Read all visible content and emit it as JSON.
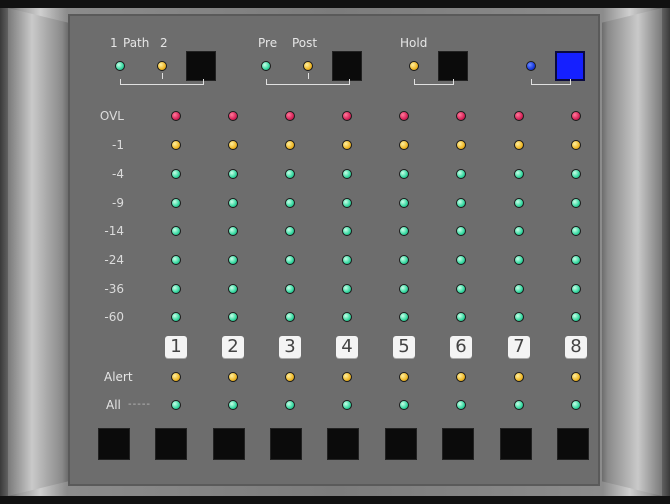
{
  "header": {
    "path_one_label": "1",
    "path_label": "Path",
    "path_two_label": "2",
    "pre_label": "Pre",
    "post_label": "Post",
    "hold_label": "Hold"
  },
  "rows": [
    "OVL",
    "-1",
    "-4",
    "-9",
    "-14",
    "-24",
    "-36",
    "-60"
  ],
  "channels": [
    "1",
    "2",
    "3",
    "4",
    "5",
    "6",
    "7",
    "8"
  ],
  "alert_label": "Alert",
  "all_label": "All",
  "all_dash": "-----",
  "colors": {
    "ovl": "red",
    "minus1": "yellow",
    "levels": "green",
    "alert": "yellow",
    "all": "green",
    "accent": "#1520ff"
  }
}
